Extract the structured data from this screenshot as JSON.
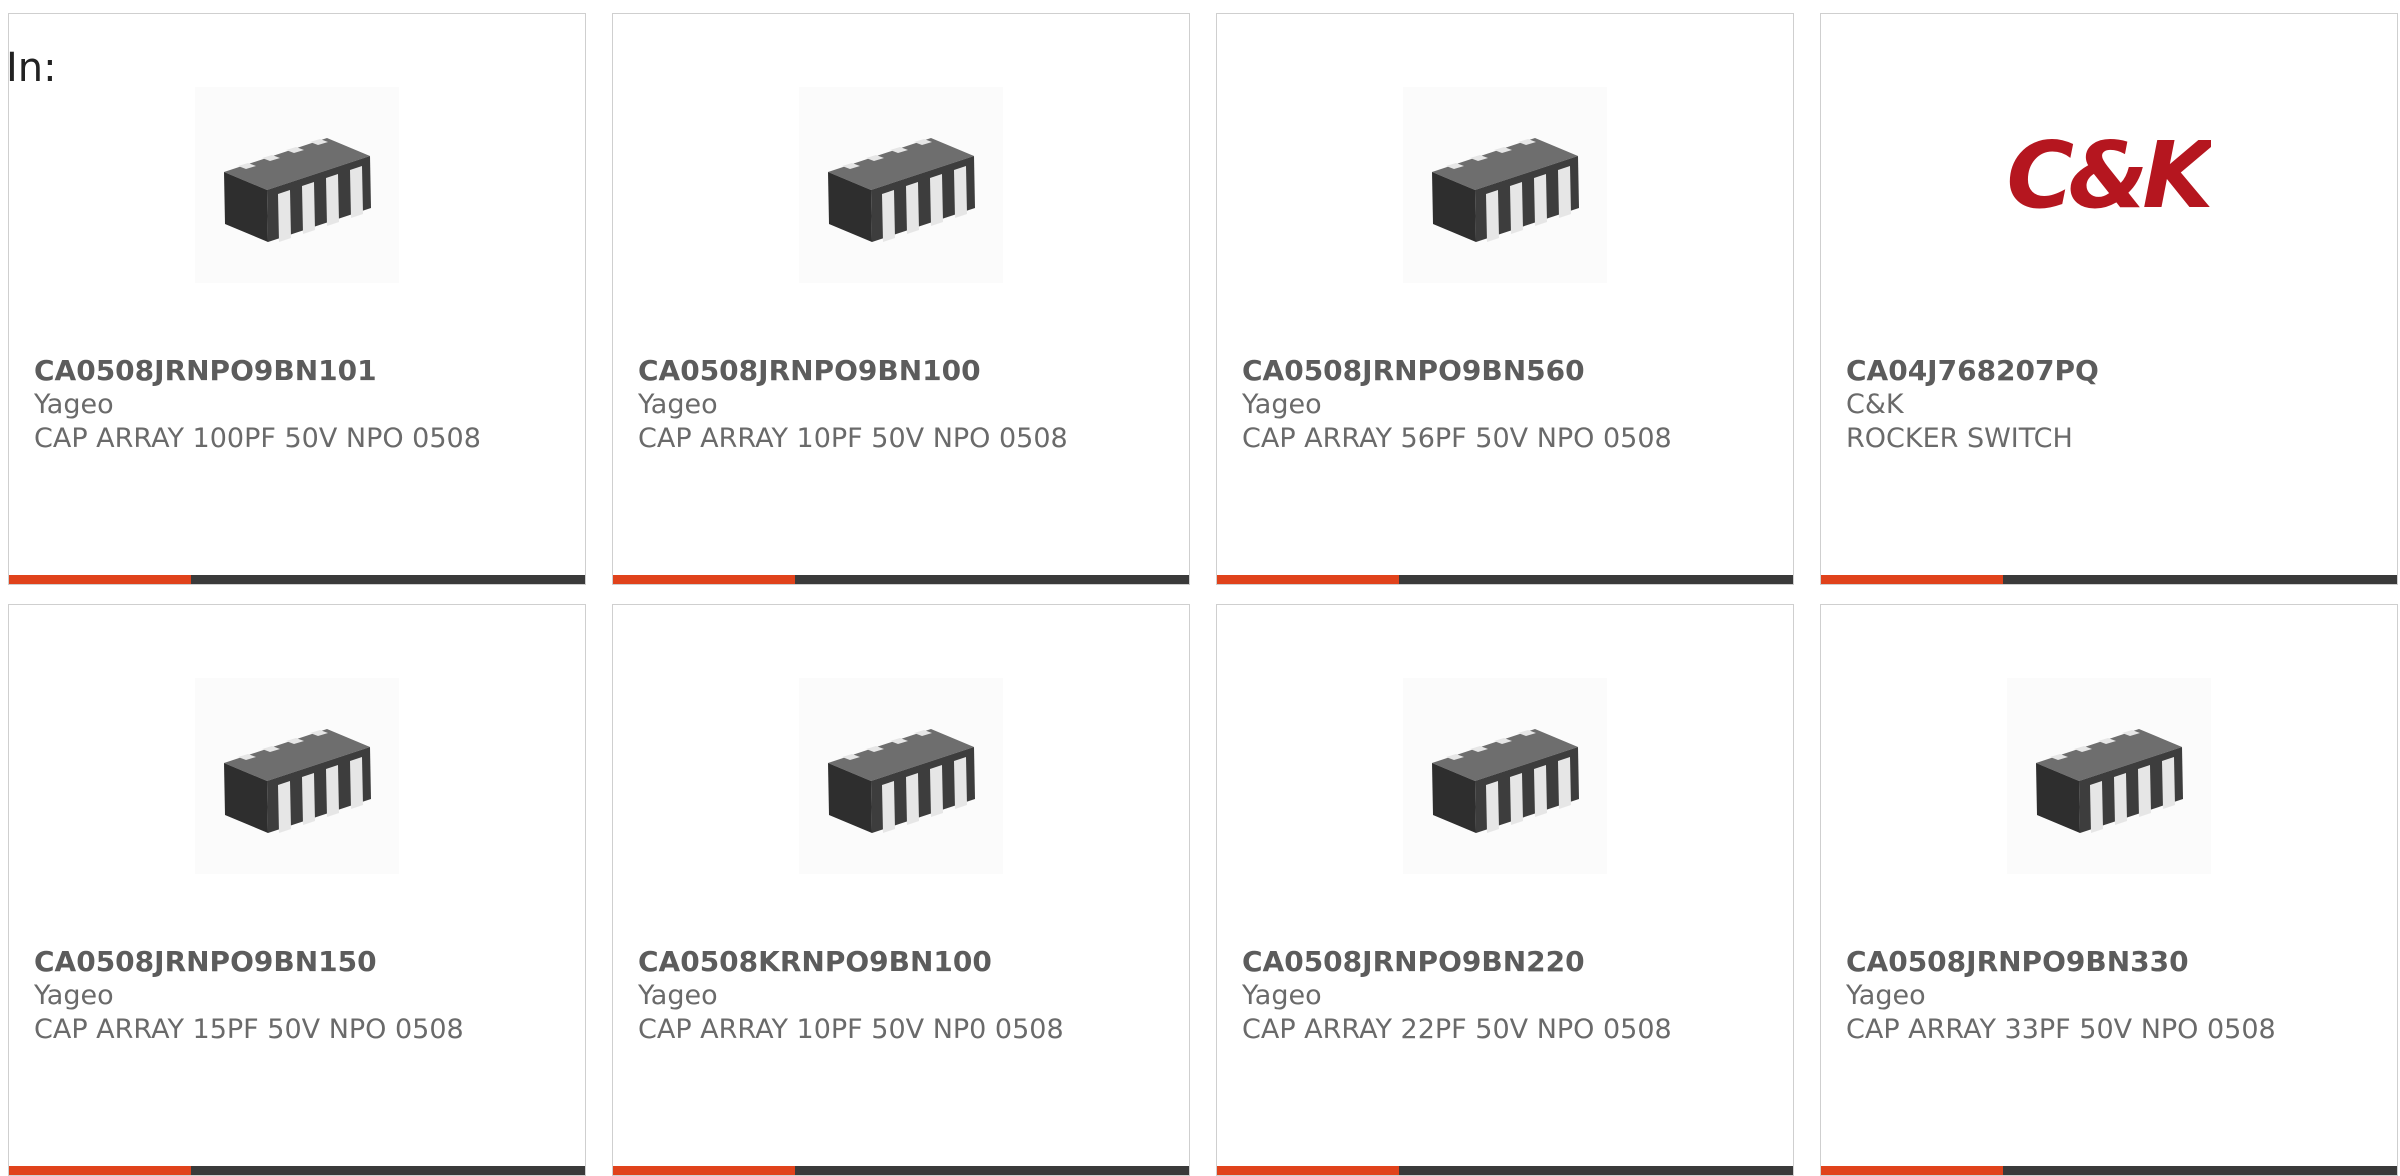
{
  "filter_label": "In:",
  "colors": {
    "accent": "#e0421b",
    "bar": "#3a3a3a",
    "card_border": "#cfcfcf",
    "part_text": "#5c5c5c",
    "meta_text": "#6a6a6a",
    "ck_logo_red": "#b5161f"
  },
  "products": [
    {
      "part": "CA0508JRNPO9BN101",
      "maker": "Yageo",
      "desc": "CAP ARRAY 100PF 50V NPO 0508",
      "image": "chip-array-image"
    },
    {
      "part": "CA0508JRNPO9BN100",
      "maker": "Yageo",
      "desc": "CAP ARRAY 10PF 50V NPO 0508",
      "image": "chip-array-image"
    },
    {
      "part": "CA0508JRNPO9BN560",
      "maker": "Yageo",
      "desc": "CAP ARRAY 56PF 50V NPO 0508",
      "image": "chip-array-image"
    },
    {
      "part": "CA04J768207PQ",
      "maker": "C&K",
      "desc": "ROCKER SWITCH",
      "image": "ck-logo",
      "logo_text": "C&K"
    },
    {
      "part": "CA0508JRNPO9BN150",
      "maker": "Yageo",
      "desc": "CAP ARRAY 15PF 50V NPO 0508",
      "image": "chip-array-image"
    },
    {
      "part": "CA0508KRNPO9BN100",
      "maker": "Yageo",
      "desc": "CAP ARRAY 10PF 50V NP0 0508",
      "image": "chip-array-image"
    },
    {
      "part": "CA0508JRNPO9BN220",
      "maker": "Yageo",
      "desc": "CAP ARRAY 22PF 50V NPO 0508",
      "image": "chip-array-image"
    },
    {
      "part": "CA0508JRNPO9BN330",
      "maker": "Yageo",
      "desc": "CAP ARRAY 33PF 50V NPO 0508",
      "image": "chip-array-image"
    }
  ]
}
